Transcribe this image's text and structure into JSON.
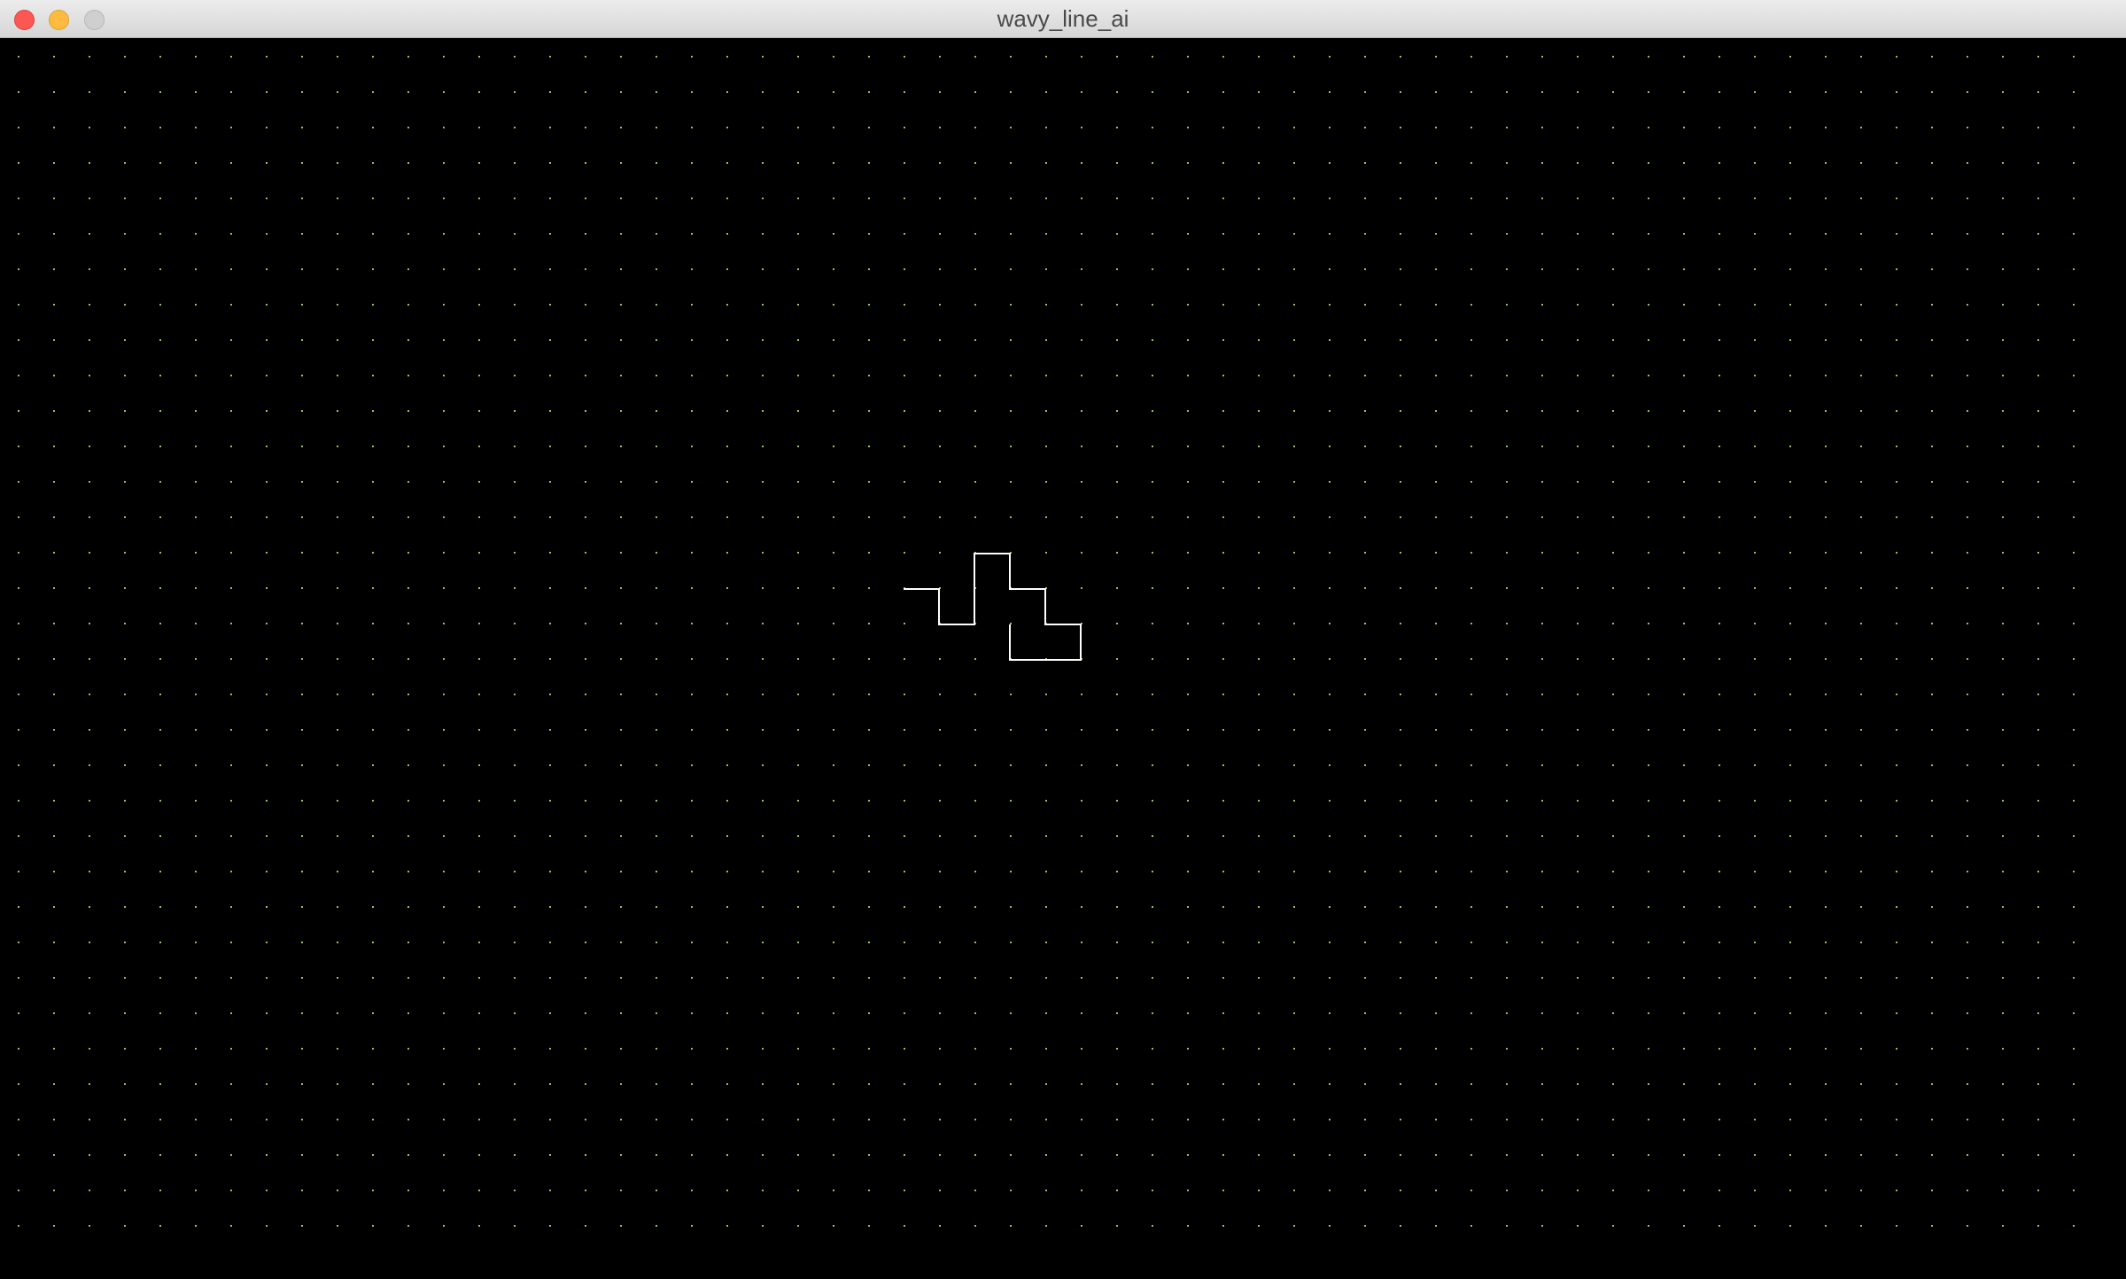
{
  "window": {
    "title": "wavy_line_ai",
    "controls": {
      "close": "close",
      "minimize": "minimize",
      "zoom": "zoom"
    }
  },
  "canvas": {
    "background_color": "#000000",
    "grid_dot_color": "#b9b34a",
    "line_color": "#ffffff"
  }
}
